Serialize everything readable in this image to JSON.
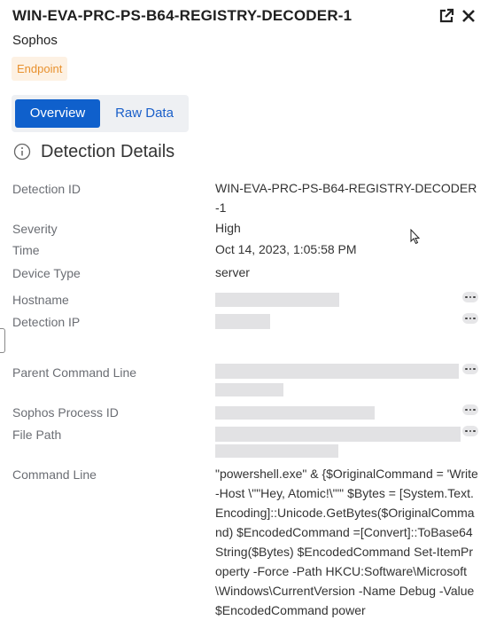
{
  "header": {
    "title": "WIN-EVA-PRC-PS-B64-REGISTRY-DECODER-1",
    "vendor": "Sophos",
    "badge": "Endpoint"
  },
  "tabs": [
    {
      "label": "Overview",
      "active": true
    },
    {
      "label": "Raw Data",
      "active": false
    }
  ],
  "section": {
    "title": "Detection Details"
  },
  "fields": {
    "detection_id": {
      "label": "Detection ID",
      "value": "WIN-EVA-PRC-PS-B64-REGISTRY-DECODER-1"
    },
    "severity": {
      "label": "Severity",
      "value": "High"
    },
    "time": {
      "label": "Time",
      "value": "Oct 14, 2023, 1:05:58 PM"
    },
    "device_type": {
      "label": "Device Type",
      "value": "server"
    },
    "hostname": {
      "label": "Hostname"
    },
    "detection_ip": {
      "label": "Detection IP"
    },
    "parent_command_line": {
      "label": "Parent Command Line"
    },
    "sophos_process_id": {
      "label": "Sophos Process ID"
    },
    "file_path": {
      "label": "File Path"
    },
    "command_line": {
      "label": "Command Line",
      "value": "\"powershell.exe\" & {$OriginalCommand = 'Write-Host \\\"\"Hey, Atomic!\\\"\"' $Bytes = [System.Text.Encoding]::Unicode.GetBytes($OriginalCommand) $EncodedCommand =[Convert]::ToBase64String($Bytes) $EncodedCommand Set-ItemProperty -Force -Path HKCU:Software\\Microsoft\\Windows\\CurrentVersion -Name Debug -Value $EncodedCommand power"
    }
  },
  "colors": {
    "primary": "#0f60cc",
    "badge_bg": "#fdf1e3",
    "badge_text": "#e8912e",
    "label": "#6b6e74",
    "redaction": "#e2e2e4"
  },
  "icons": [
    "external-link-icon",
    "close-icon",
    "info-icon",
    "more-options-icon",
    "mouse-cursor-icon"
  ]
}
